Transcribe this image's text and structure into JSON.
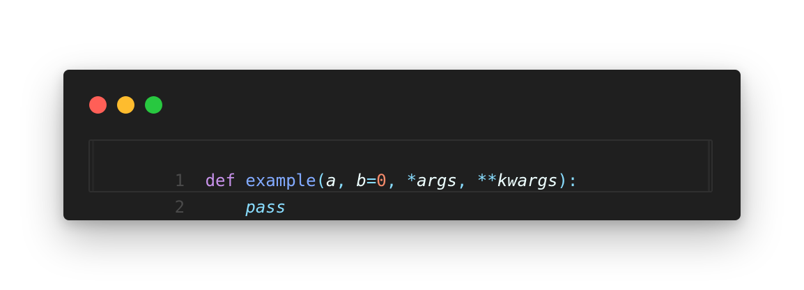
{
  "window": {
    "controls": {
      "close_color": "#ff5f57",
      "minimize_color": "#febc2e",
      "maximize_color": "#28c840"
    }
  },
  "editor": {
    "lines": [
      {
        "number": "1",
        "tokens": {
          "kw": "def",
          "sp1": " ",
          "fn": "example",
          "lparen": "(",
          "a": "a",
          "comma1": ", ",
          "b": "b",
          "eq": "=",
          "zero": "0",
          "comma2": ", ",
          "star": "*",
          "args": "args",
          "comma3": ", ",
          "dstar": "**",
          "kwargs": "kwargs",
          "rparen": ")",
          "colon": ":"
        }
      },
      {
        "number": "2",
        "tokens": {
          "indent": "    ",
          "pass": "pass"
        }
      }
    ]
  }
}
